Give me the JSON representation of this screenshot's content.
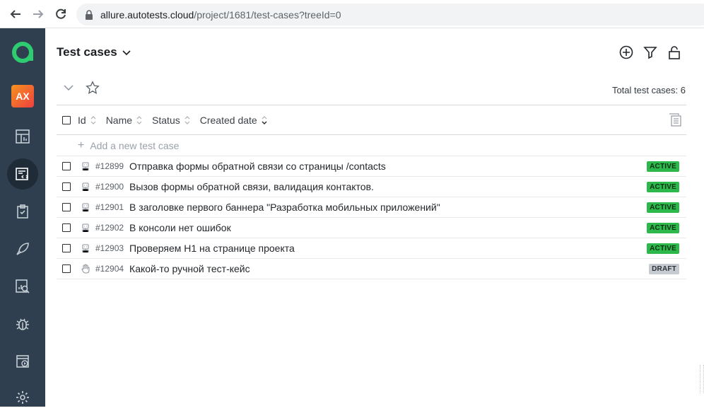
{
  "browser": {
    "url_host": "allure.autotests.cloud",
    "url_path": "/project/1681/test-cases?treeId=0"
  },
  "sidebar": {
    "avatar_initials": "AX"
  },
  "header": {
    "title": "Test cases"
  },
  "toolbar": {
    "total_label": "Total test cases: 6"
  },
  "table": {
    "columns": [
      "Id",
      "Name",
      "Status",
      "Created date"
    ],
    "add_label": "Add a new test case",
    "rows": [
      {
        "id": "#12899",
        "name": "Отправка формы обратной связи со страницы /contacts",
        "status": "ACTIVE",
        "type": "automated"
      },
      {
        "id": "#12900",
        "name": "Вызов формы обратной связи, валидация контактов.",
        "status": "ACTIVE",
        "type": "automated"
      },
      {
        "id": "#12901",
        "name": "В заголовке первого баннера \"Разработка мобильных приложений\"",
        "status": "ACTIVE",
        "type": "automated"
      },
      {
        "id": "#12902",
        "name": "В консоли нет ошибок",
        "status": "ACTIVE",
        "type": "automated"
      },
      {
        "id": "#12903",
        "name": "Проверяем H1 на странице проекта",
        "status": "ACTIVE",
        "type": "automated"
      },
      {
        "id": "#12904",
        "name": "Какой-то ручной тест-кейс",
        "status": "DRAFT",
        "type": "manual"
      }
    ]
  },
  "colors": {
    "sidebar_bg": "#2f3f4f",
    "active_badge": "#2db84b",
    "draft_badge": "#c5cbd1",
    "logo": "#2ecc71"
  }
}
